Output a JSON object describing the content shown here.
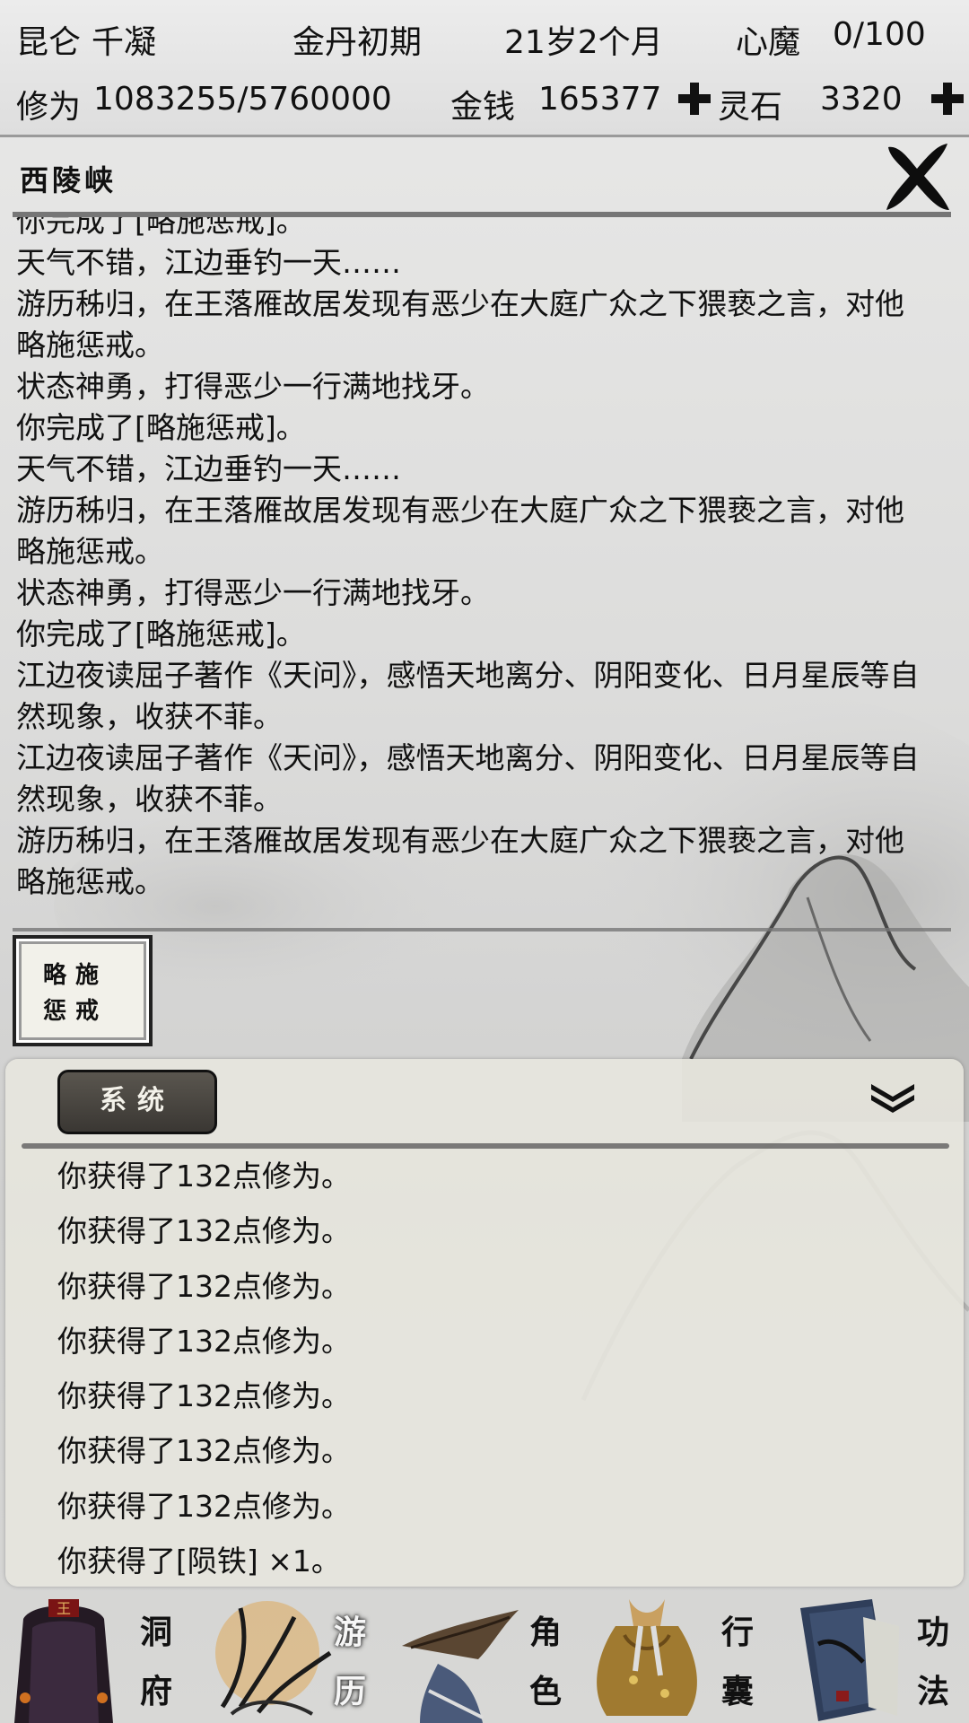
{
  "status": {
    "sect": "昆仑",
    "name": "千凝",
    "realm": "金丹初期",
    "age": "21岁2个月",
    "demon_label": "心魔",
    "demon_value": "0/100",
    "cultivation_label": "修为",
    "cultivation_value": "1083255/5760000",
    "money_label": "金钱",
    "money_value": "165377",
    "spirit_stone_label": "灵石",
    "spirit_stone_value": "3320"
  },
  "location": {
    "title": "西陵峡",
    "log": [
      "你完成了[略施惩戒]。",
      "天气不错，江边垂钓一天……",
      "游历秭归，在王落雁故居发现有恶少在大庭广众之下猥亵之言，对他略施惩戒。",
      "状态神勇，打得恶少一行满地找牙。",
      "你完成了[略施惩戒]。",
      "天气不错，江边垂钓一天……",
      "游历秭归，在王落雁故居发现有恶少在大庭广众之下猥亵之言，对他略施惩戒。",
      "状态神勇，打得恶少一行满地找牙。",
      "你完成了[略施惩戒]。",
      "江边夜读屈子著作《天问》，感悟天地离分、阴阳变化、日月星辰等自然现象，收获不菲。",
      "江边夜读屈子著作《天问》，感悟天地离分、阴阳变化、日月星辰等自然现象，收获不菲。",
      "游历秭归，在王落雁故居发现有恶少在大庭广众之下猥亵之言，对他略施惩戒。"
    ],
    "event_card": {
      "line1": "略施",
      "line2": "惩戒"
    }
  },
  "system": {
    "tab_label": "系统",
    "messages": [
      "你获得了132点修为。",
      "你获得了132点修为。",
      "你获得了132点修为。",
      "你获得了132点修为。",
      "你获得了132点修为。",
      "你获得了132点修为。",
      "你获得了132点修为。",
      "你获得了[陨铁] ×1。"
    ]
  },
  "nav": [
    {
      "c1": "洞",
      "c2": "府",
      "icon": "cave-dwelling-icon",
      "active": false
    },
    {
      "c1": "游",
      "c2": "历",
      "icon": "travel-icon",
      "active": true
    },
    {
      "c1": "角",
      "c2": "色",
      "icon": "character-icon",
      "active": false
    },
    {
      "c1": "行",
      "c2": "囊",
      "icon": "bag-icon",
      "active": false
    },
    {
      "c1": "功",
      "c2": "法",
      "icon": "scroll-icon",
      "active": false
    }
  ]
}
